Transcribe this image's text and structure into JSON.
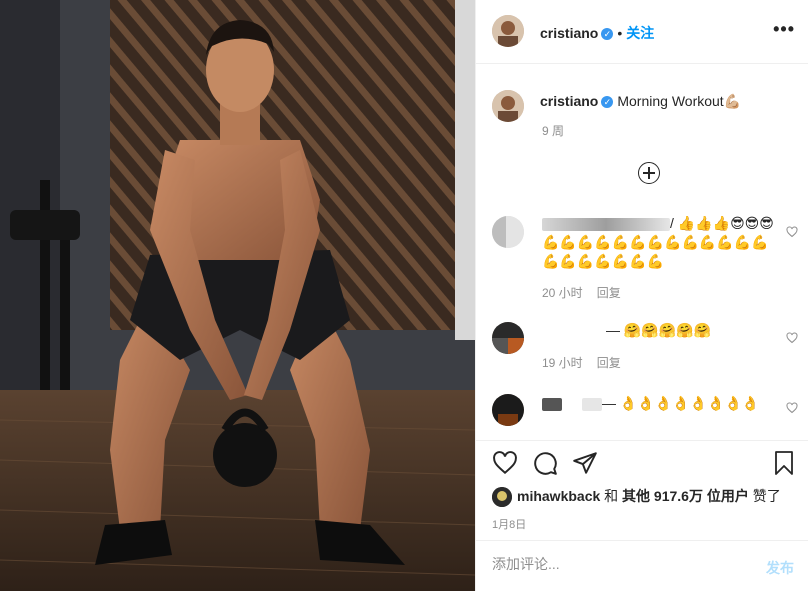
{
  "header": {
    "username": "cristiano",
    "verified_icon": "verified-badge-icon",
    "separator": "•",
    "follow_label": "关注",
    "more_label": "•••"
  },
  "caption": {
    "username": "cristiano",
    "text": "Morning Workout💪🏼",
    "time": "9 周"
  },
  "comments": [
    {
      "text": "/ 👍👍👍😎😎😎💪💪💪💪💪💪💪💪💪💪💪💪💪💪💪💪💪💪💪💪",
      "time": "20 小时",
      "reply": "回复"
    },
    {
      "text": "— 🤗🤗🤗🤗🤗",
      "time": "19 小时",
      "reply": "回复"
    },
    {
      "text": "— 👌👌👌👌👌👌👌👌",
      "time": "",
      "reply": ""
    }
  ],
  "likes": {
    "user": "mihawkback",
    "joiner": "和",
    "others": "其他 917.6万 位用户",
    "suffix": "赞了"
  },
  "date": "1月8日",
  "comment_input": {
    "placeholder": "添加评论..."
  },
  "post_label": "发布",
  "colors": {
    "link": "#0095f6",
    "post_disabled": "#b2dffc",
    "verified": "#3897f0",
    "muted": "#8e8e8e",
    "text": "#262626"
  },
  "icons": [
    "heart-icon",
    "comment-icon",
    "share-icon",
    "bookmark-icon",
    "add-comments-icon",
    "more-options-icon"
  ]
}
